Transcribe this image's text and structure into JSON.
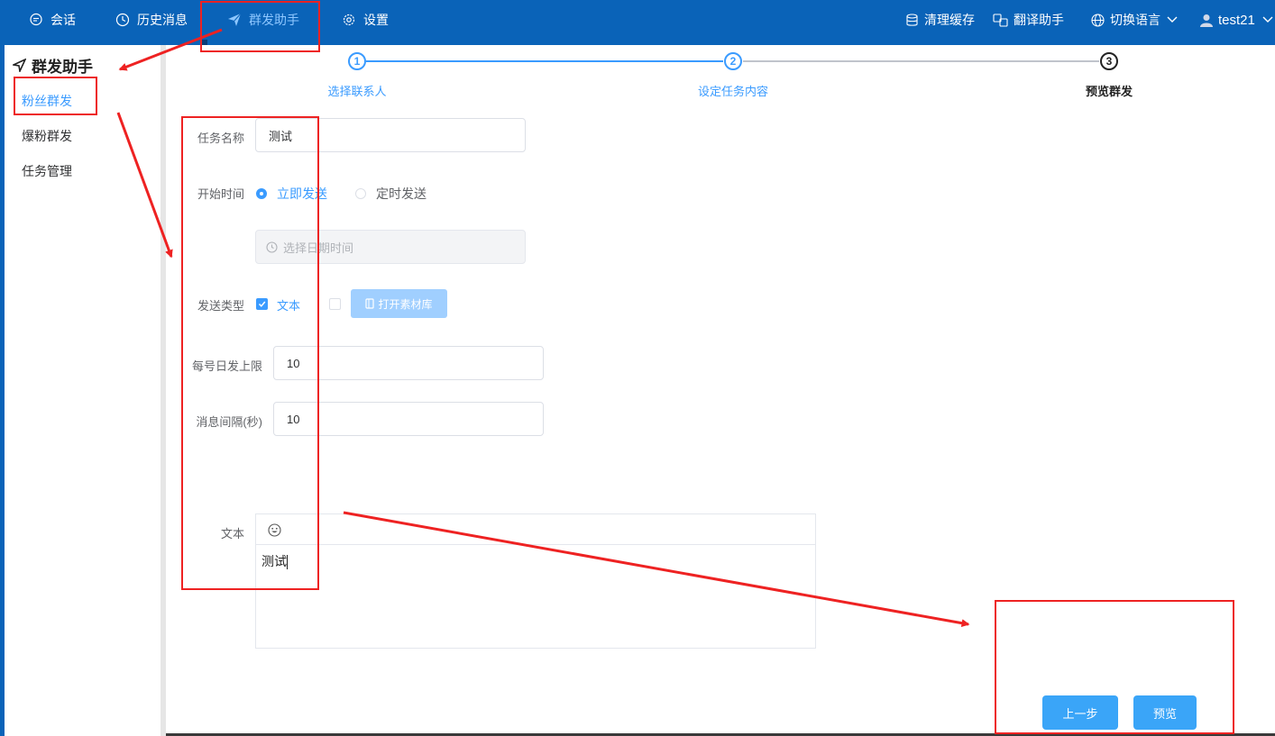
{
  "nav": {
    "items": [
      {
        "label": "会话",
        "icon": "chat-bubble-icon"
      },
      {
        "label": "历史消息",
        "icon": "clock-icon"
      },
      {
        "label": "群发助手",
        "icon": "send-plane-icon",
        "active": true
      },
      {
        "label": "设置",
        "icon": "gear-icon"
      }
    ],
    "right": {
      "clear_cache": "清理缓存",
      "translate": "翻译助手",
      "language": "切换语言",
      "user": "test21"
    }
  },
  "sidebar": {
    "title": "群发助手",
    "items": [
      {
        "label": "粉丝群发",
        "active": true
      },
      {
        "label": "爆粉群发"
      },
      {
        "label": "任务管理"
      }
    ]
  },
  "steps": [
    {
      "num": "1",
      "label": "选择联系人",
      "state": "done"
    },
    {
      "num": "2",
      "label": "设定任务内容",
      "state": "done"
    },
    {
      "num": "3",
      "label": "预览群发",
      "state": "current"
    }
  ],
  "form": {
    "task_name": {
      "label": "任务名称",
      "value": "测试"
    },
    "start_time": {
      "label": "开始时间",
      "option_now": "立即发送",
      "option_scheduled": "定时发送",
      "selected": "立即发送"
    },
    "datetime": {
      "placeholder": "选择日期时间"
    },
    "send_type": {
      "label": "发送类型",
      "text_option": "文本",
      "text_checked": true,
      "material_checked": false,
      "material_button": "打开素材库"
    },
    "daily_limit": {
      "label": "每号日发上限",
      "value": "10"
    },
    "interval": {
      "label": "消息间隔(秒)",
      "value": "10"
    },
    "text": {
      "label": "文本",
      "content": "测试"
    }
  },
  "buttons": {
    "prev": "上一步",
    "preview": "预览"
  },
  "colors": {
    "topbar": "#0a63b8",
    "accent": "#3a9bff",
    "annotation": "#ee2222",
    "primary_button": "#3aa5f8"
  }
}
